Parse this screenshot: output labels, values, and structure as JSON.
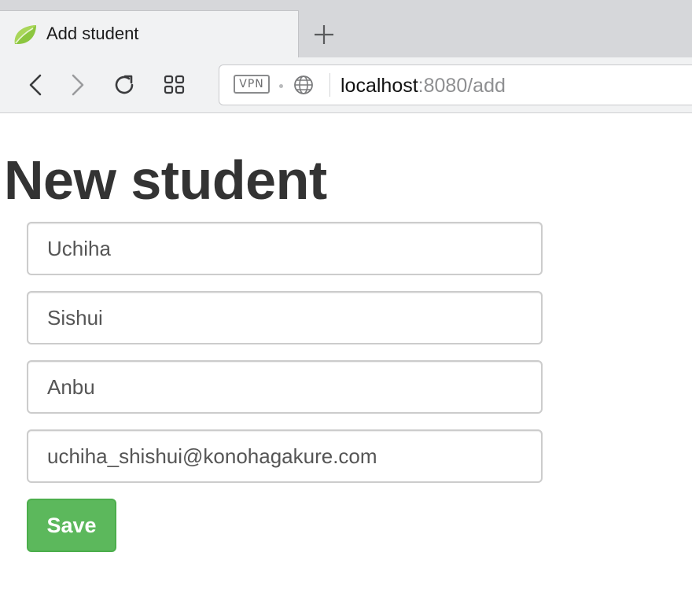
{
  "browser": {
    "tab": {
      "title": "Add student",
      "favicon": "spring-leaf-icon"
    },
    "new_tab_icon": "plus-icon",
    "nav": {
      "back_icon": "back-arrow-icon",
      "forward_icon": "forward-arrow-icon",
      "reload_icon": "reload-icon",
      "tabs_overview_icon": "grid-icon"
    },
    "address_bar": {
      "vpn_label": "VPN",
      "site_icon": "globe-icon",
      "url_host": "localhost",
      "url_rest": ":8080/add"
    }
  },
  "page": {
    "title": "New student",
    "form": {
      "fields": [
        {
          "name": "first-name",
          "value": "Uchiha"
        },
        {
          "name": "last-name",
          "value": "Sishui"
        },
        {
          "name": "faculty",
          "value": "Anbu"
        },
        {
          "name": "email",
          "value": "uchiha_shishui@konohagakure.com"
        }
      ],
      "save_label": "Save"
    }
  },
  "colors": {
    "save_button": "#5cb85c",
    "save_button_border": "#4cae4c",
    "title_text": "#333333",
    "field_border": "#cccccc",
    "favicon_leaf": "#8cc63f"
  }
}
